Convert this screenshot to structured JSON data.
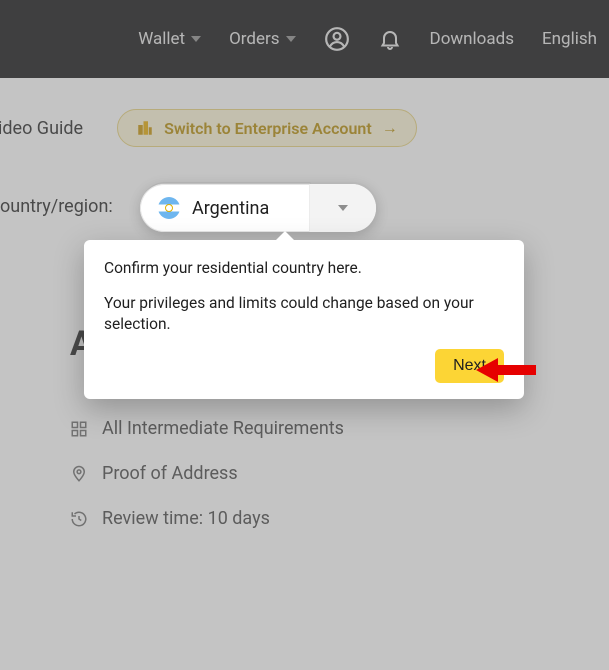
{
  "topbar": {
    "wallet": "Wallet",
    "orders": "Orders",
    "downloads": "Downloads",
    "language": "English"
  },
  "switch": {
    "label": "Switch to Enterprise Account"
  },
  "video_guide": "ideo Guide",
  "country": {
    "label": "ountry/region:",
    "selected": "Argentina"
  },
  "section_letter": "A",
  "requirements": {
    "intermediate": "All Intermediate Requirements",
    "address": "Proof of Address",
    "review": "Review time: 10 days"
  },
  "popover": {
    "line1": "Confirm your residential country here.",
    "line2": "Your privileges and limits could change based on your selection.",
    "next": "Next"
  }
}
